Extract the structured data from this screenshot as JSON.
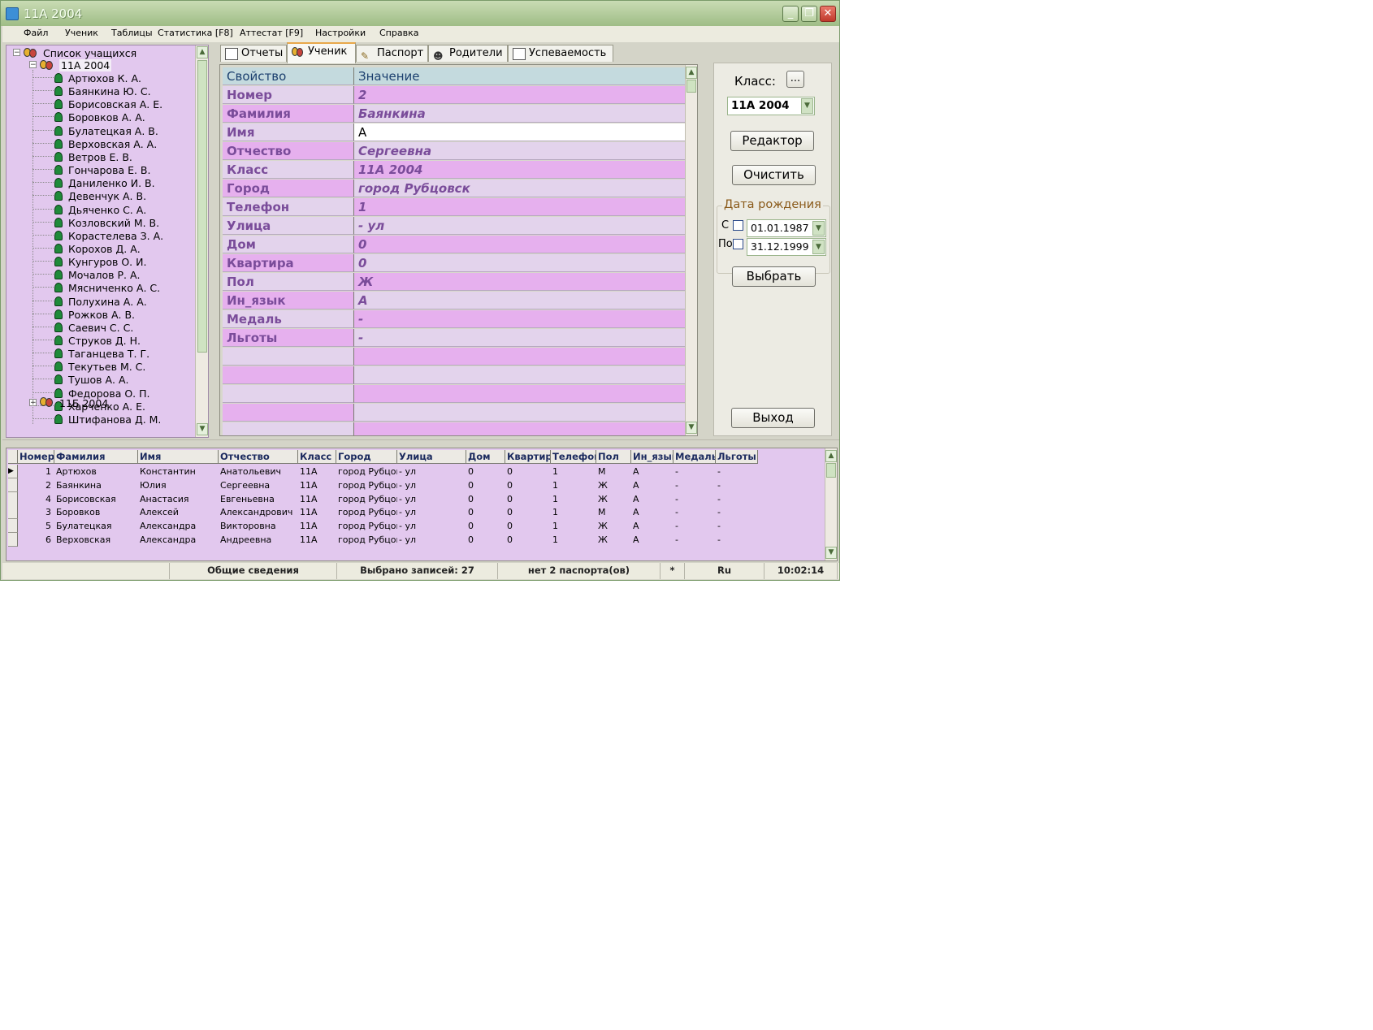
{
  "window": {
    "title": "11А 2004"
  },
  "menu": [
    "Файл",
    "Ученик",
    "Таблицы",
    "Статистика [F8]",
    "Аттестат [F9]",
    "Настройки",
    "Справка"
  ],
  "tree": {
    "root_label": "Список учащихся",
    "group_open": "11А 2004",
    "students": [
      "Артюхов К. А.",
      "Баянкина Ю. С.",
      "Борисовская А. Е.",
      "Боровков А. А.",
      "Булатецкая А. В.",
      "Верховская А. А.",
      "Ветров Е. В.",
      "Гончарова Е. В.",
      "Даниленко И. В.",
      "Девенчук А. В.",
      "Дьяченко С. А.",
      "Козловский М. В.",
      "Корастелева З. А.",
      "Корохов Д. А.",
      "Кунгуров О. И.",
      "Мочалов Р. А.",
      "Мясниченко А. С.",
      "Полухина А. А.",
      "Рожков А. В.",
      "Саевич С. С.",
      "Струков Д. Н.",
      "Таганцева Т. Г.",
      "Текутьев М. С.",
      "Тушов А. А.",
      "Федорова О. П.",
      "Харченко А. Е.",
      "Штифанова Д. М."
    ],
    "group_closed": "11Б 2004"
  },
  "tabs": [
    {
      "label": "Отчеты",
      "icon": "report-icon"
    },
    {
      "label": "Ученик",
      "icon": "students-icon",
      "active": true
    },
    {
      "label": "Паспорт",
      "icon": "passport-icon"
    },
    {
      "label": "Родители",
      "icon": "parents-icon"
    },
    {
      "label": "Успеваемость",
      "icon": "grades-icon"
    }
  ],
  "props": {
    "header": {
      "prop": "Свойство",
      "value": "Значение"
    },
    "rows": [
      {
        "prop": "Номер",
        "value": "2"
      },
      {
        "prop": "Фамилия",
        "value": "Баянкина"
      },
      {
        "prop": "Имя",
        "value": "А"
      },
      {
        "prop": "Отчество",
        "value": "Сергеевна"
      },
      {
        "prop": "Класс",
        "value": "11А 2004"
      },
      {
        "prop": "Город",
        "value": "город Рубцовск"
      },
      {
        "prop": "Телефон",
        "value": "1"
      },
      {
        "prop": "Улица",
        "value": "- ул"
      },
      {
        "prop": "Дом",
        "value": "0"
      },
      {
        "prop": "Квартира",
        "value": "0"
      },
      {
        "prop": "Пол",
        "value": "Ж"
      },
      {
        "prop": "Ин_язык",
        "value": "А"
      },
      {
        "prop": "Медаль",
        "value": "-"
      },
      {
        "prop": "Льготы",
        "value": "-"
      }
    ]
  },
  "right_panel": {
    "class_label": "Класс:",
    "class_more": "...",
    "class_value": "11А 2004",
    "editor_button": "Редактор",
    "clear_button": "Очистить",
    "birth_group": "Дата рождения",
    "from_label": "С",
    "from_date": "01.01.1987",
    "to_label": "По",
    "to_date": "31.12.1999",
    "select_button": "Выбрать",
    "exit_button": "Выход"
  },
  "table": {
    "columns": [
      "Номер",
      "Фамилия",
      "Имя",
      "Отчество",
      "Класс",
      "Город",
      "Улица",
      "Дом",
      "Квартира",
      "Телефон",
      "Пол",
      "Ин_язык",
      "Медаль",
      "Льготы"
    ],
    "rows": [
      [
        "1",
        "Артюхов",
        "Константин",
        "Анатольевич",
        "11А",
        "город Рубцовск",
        "- ул",
        "0",
        "0",
        "1",
        "М",
        "А",
        "-",
        "-"
      ],
      [
        "2",
        "Баянкина",
        "Юлия",
        "Сергеевна",
        "11А",
        "город Рубцовск",
        "- ул",
        "0",
        "0",
        "1",
        "Ж",
        "А",
        "-",
        "-"
      ],
      [
        "4",
        "Борисовская",
        "Анастасия",
        "Евгеньевна",
        "11А",
        "город Рубцовск",
        "- ул",
        "0",
        "0",
        "1",
        "Ж",
        "А",
        "-",
        "-"
      ],
      [
        "3",
        "Боровков",
        "Алексей",
        "Александрович",
        "11А",
        "город Рубцовск",
        "- ул",
        "0",
        "0",
        "1",
        "М",
        "А",
        "-",
        "-"
      ],
      [
        "5",
        "Булатецкая",
        "Александра",
        "Викторовна",
        "11А",
        "город Рубцовск",
        "- ул",
        "0",
        "0",
        "1",
        "Ж",
        "А",
        "-",
        "-"
      ],
      [
        "6",
        "Верховская",
        "Александра",
        "Андреевна",
        "11А",
        "город Рубцовск",
        "- ул",
        "0",
        "0",
        "1",
        "Ж",
        "А",
        "-",
        "-"
      ]
    ]
  },
  "status": {
    "section": "Общие сведения",
    "records": "Выбрано записей: 27",
    "passports": "нет 2 паспорта(ов)",
    "flag": "*",
    "lang": "Ru",
    "time": "10:02:14"
  },
  "colors": {
    "row_pink": "#e6b0ee",
    "row_lavender": "#e3d3ec",
    "tree_bg": "#e2c8ee",
    "titlebar": "#a7c38e"
  }
}
